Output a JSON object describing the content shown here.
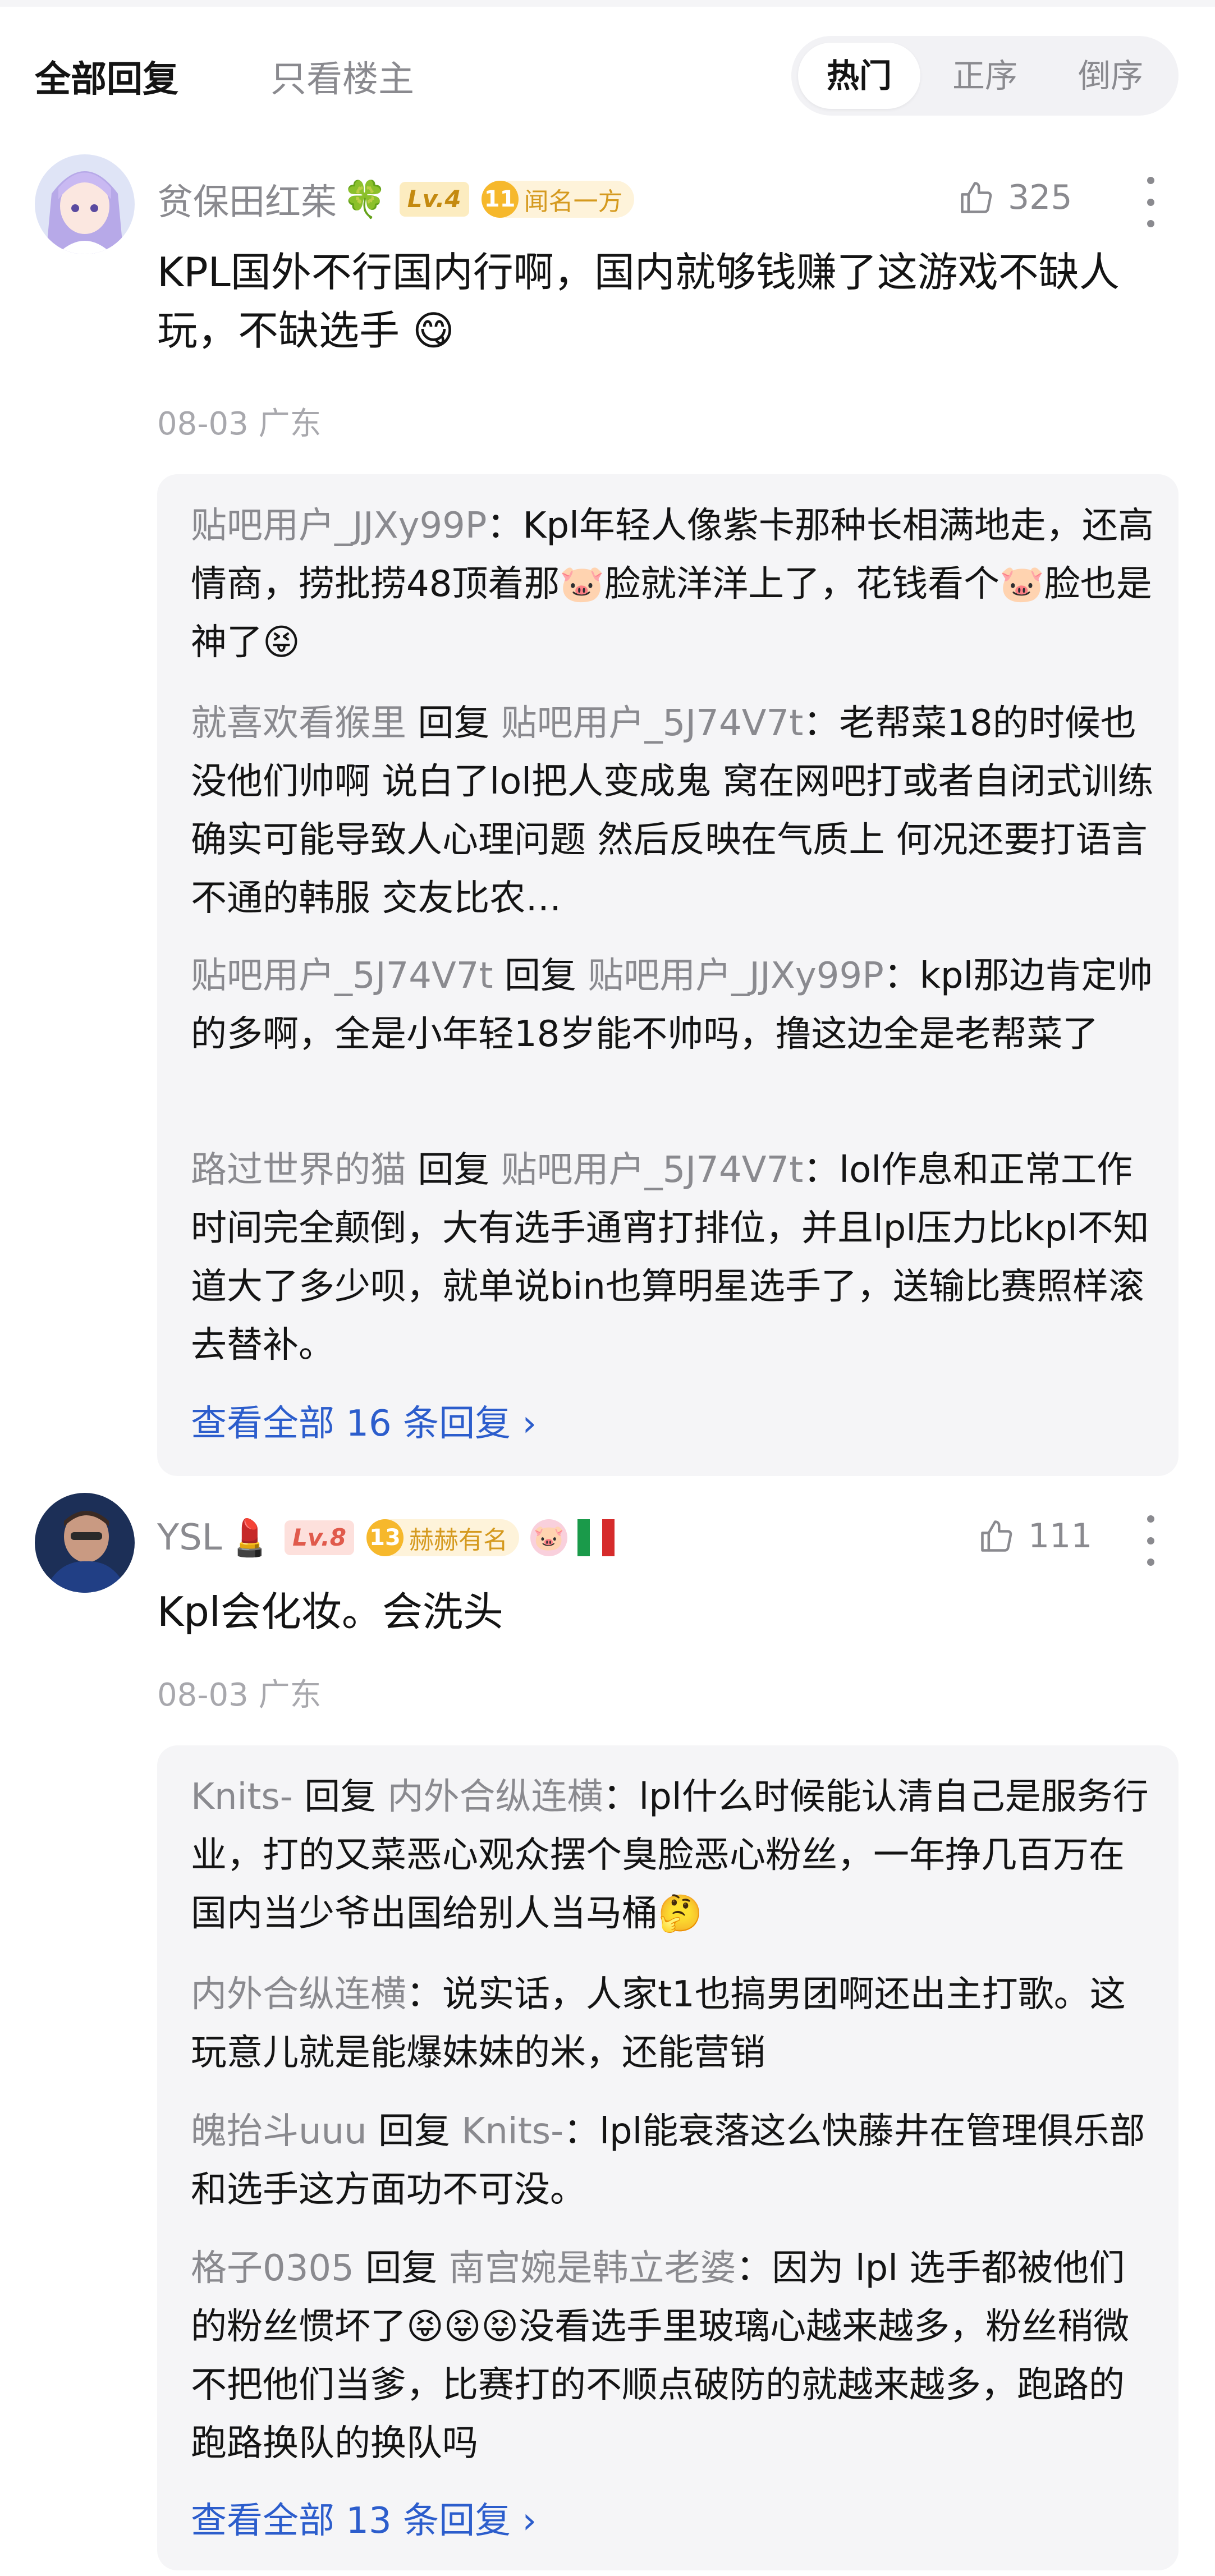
{
  "tabs": {
    "all": "全部回复",
    "op_only": "只看楼主"
  },
  "sort": {
    "hot": "热门",
    "asc": "正序",
    "desc": "倒序",
    "active": "hot"
  },
  "comments": [
    {
      "username": "贫保田红茱",
      "name_emoji": "🍀",
      "level": "Lv.4",
      "medal_num": "11",
      "medal_text": "闻名一方",
      "likes": "325",
      "text": "KPL国外不行国内行啊，国内就够钱赚了这游戏不缺人玩，不缺选手 😋",
      "meta": "08-03 广东",
      "replies": [
        {
          "user": "贴吧用户_JJXy99P",
          "word": "",
          "target": "",
          "text": "：Kpl年轻人像紫卡那种长相满地走，还高情商，捞批捞48顶着那🐷脸就洋洋上了，花钱看个🐷脸也是神了😝"
        },
        {
          "user": "就喜欢看猴里",
          "word": "回复",
          "target": "贴吧用户_5J74V7t",
          "text": "：老帮菜18的时候也没他们帅啊 说白了lol把人变成鬼 窝在网吧打或者自闭式训练确实可能导致人心理问题 然后反映在气质上 何况还要打语言不通的韩服 交友比农…"
        },
        {
          "user": "贴吧用户_5J74V7t",
          "word": "回复",
          "target": "贴吧用户_JJXy99P",
          "text": "：kpl那边肯定帅的多啊，全是小年轻18岁能不帅吗，撸这边全是老帮菜了"
        },
        {
          "user": "路过世界的猫",
          "word": "回复",
          "target": "贴吧用户_5J74V7t",
          "text": "：lol作息和正常工作时间完全颠倒，大有选手通宵打排位，并且lpl压力比kpl不知道大了多少呗，就单说bin也算明星选手了，送输比赛照样滚去替补。"
        }
      ],
      "view_all": "查看全部 16 条回复 ›"
    },
    {
      "username": "YSL",
      "name_emoji": "💄",
      "level": "Lv.8",
      "medal_num": "13",
      "medal_text": "赫赫有名",
      "extra_badge": "🐷",
      "likes": "111",
      "text": "Kpl会化妆。会洗头",
      "meta": "08-03 广东",
      "replies": [
        {
          "user": "Knits-",
          "word": "回复",
          "target": "内外合纵连横",
          "text": "：lpl什么时候能认清自己是服务行业，打的又菜恶心观众摆个臭脸恶心粉丝，一年挣几百万在国内当少爷出国给别人当马桶🤔"
        },
        {
          "user": "内外合纵连横",
          "word": "",
          "target": "",
          "text": "：说实话，人家t1也搞男团啊还出主打歌。这玩意儿就是能爆妹妹的米，还能营销"
        },
        {
          "user": "魄抬斗uuu",
          "word": "回复",
          "target": "Knits-",
          "text": "：lpl能衰落这么快藤井在管理俱乐部和选手这方面功不可没。"
        },
        {
          "user": "格子0305",
          "word": "回复",
          "target": "南宫婉是韩立老婆",
          "text": "：因为 lpl 选手都被他们的粉丝惯坏了😝😝😝没看选手里玻璃心越来越多，粉丝稍微不把他们当爹，比赛打的不顺点破防的就越来越多，跑路的跑路换队的换队吗"
        }
      ],
      "view_all": "查看全部 13 条回复 ›"
    }
  ],
  "colors": {
    "accent": "#2c5dcc",
    "muted": "#8a8a8f",
    "reply_bg": "#f5f5f7"
  }
}
